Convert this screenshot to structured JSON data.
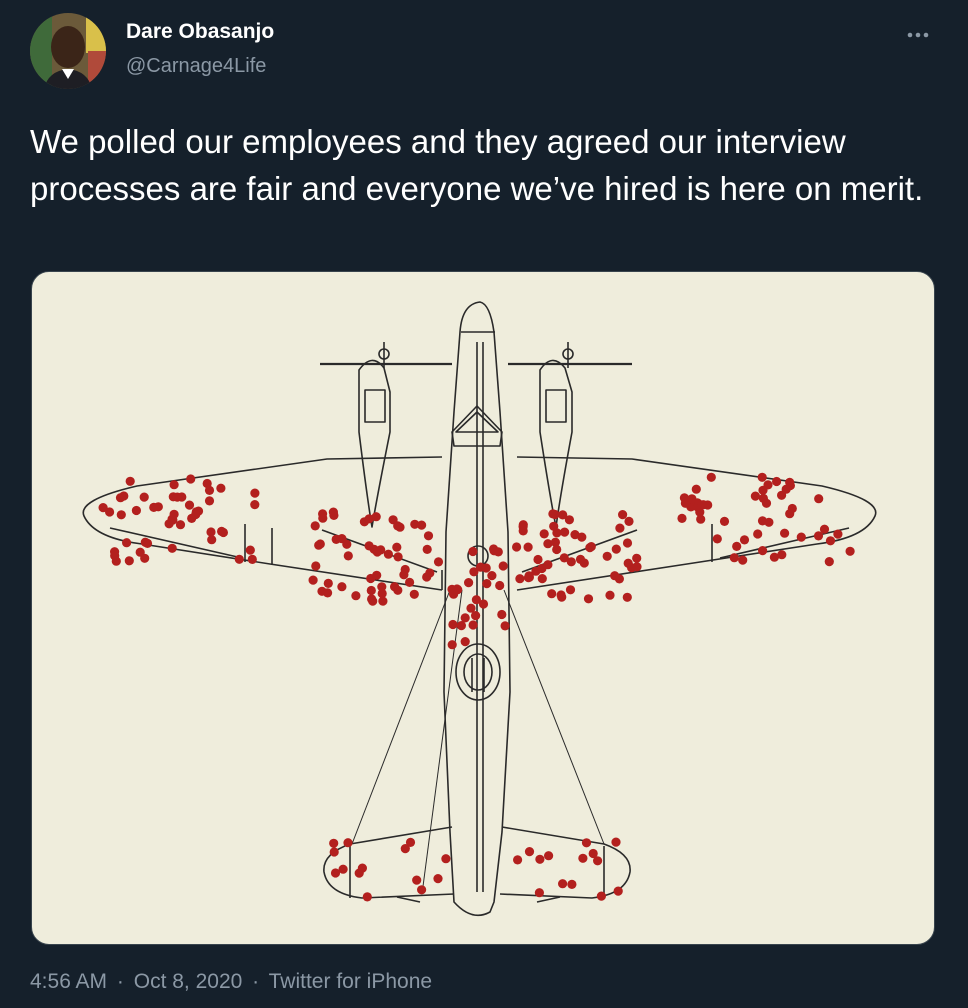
{
  "author": {
    "name": "Dare Obasanjo",
    "handle": "@Carnage4Life"
  },
  "tweet": {
    "text": "We polled our employees and they agreed our interview processes are fair and everyone we’ve hired is here on merit."
  },
  "meta": {
    "time": "4:56 AM",
    "separator": "·",
    "date": "Oct 8, 2020",
    "source": "Twitter for iPhone"
  },
  "icons": {
    "more": "more-horizontal-icon"
  },
  "colors": {
    "background": "#15202b",
    "primary_text": "#ffffff",
    "secondary_text": "#8b98a5",
    "image_background": "#efeddc",
    "bullet_holes": "#b3201e"
  }
}
